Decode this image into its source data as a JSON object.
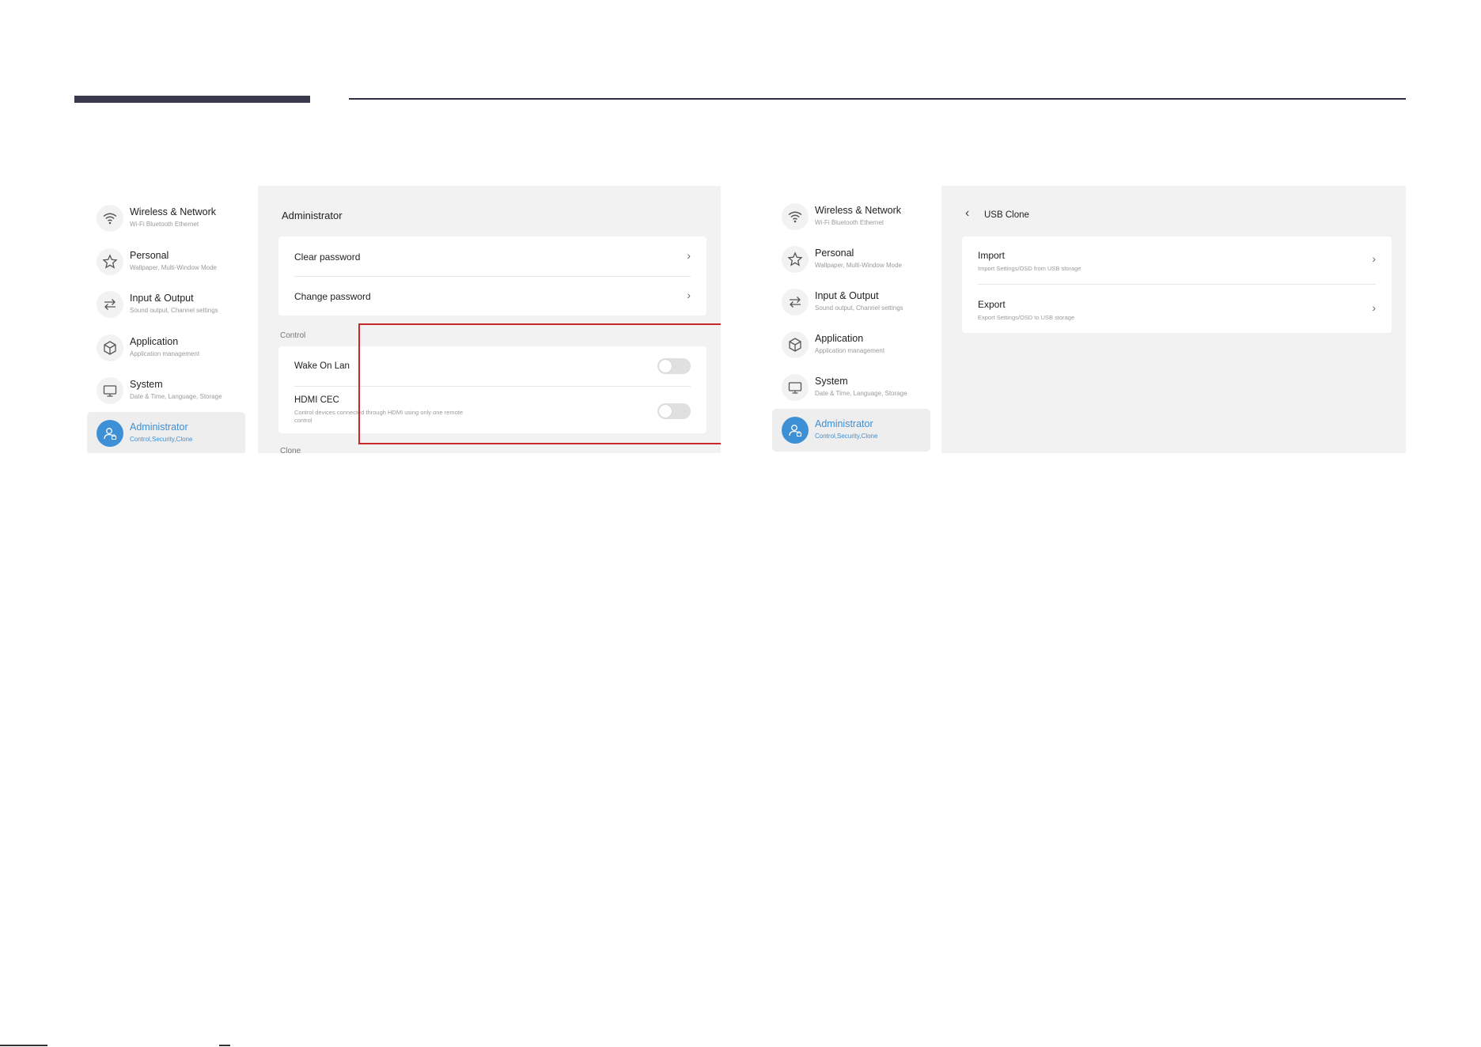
{
  "sidebar": {
    "items": [
      {
        "label": "Wireless & Network",
        "sub": "Wi-Fi Bluetooth Ethernet",
        "icon": "wifi-icon"
      },
      {
        "label": "Personal",
        "sub": "Wallpaper, Multi-Window Mode",
        "icon": "star-icon"
      },
      {
        "label": "Input & Output",
        "sub": "Sound output, Channel settings",
        "icon": "swap-arrows-icon"
      },
      {
        "label": "Application",
        "sub": "Application management",
        "icon": "cube-icon"
      },
      {
        "label": "System",
        "sub": "Date & Time, Language, Storage",
        "icon": "monitor-icon"
      },
      {
        "label": "Administrator",
        "sub": "Control,Security,Clone",
        "icon": "admin-user-icon",
        "active": true
      }
    ]
  },
  "admin_panel": {
    "title": "Administrator",
    "password_items": [
      {
        "label": "Clear password"
      },
      {
        "label": "Change password"
      }
    ],
    "control_section": "Control",
    "control_items": [
      {
        "label": "Wake On Lan",
        "sub": "",
        "state": "off"
      },
      {
        "label": "HDMI CEC",
        "sub": "Control devices connected through HDMI using only one remote control",
        "state": "off"
      }
    ],
    "clone_section": "Clone"
  },
  "usb_clone_panel": {
    "title": "USB Clone",
    "items": [
      {
        "label": "Import",
        "sub": "Import Settings/OSD from USB storage"
      },
      {
        "label": "Export",
        "sub": "Export Settings/OSD to USB storage"
      }
    ]
  },
  "colors": {
    "accent": "#3d8fd6",
    "highlight": "#c8282c",
    "panel_bg": "#f2f2f2"
  }
}
